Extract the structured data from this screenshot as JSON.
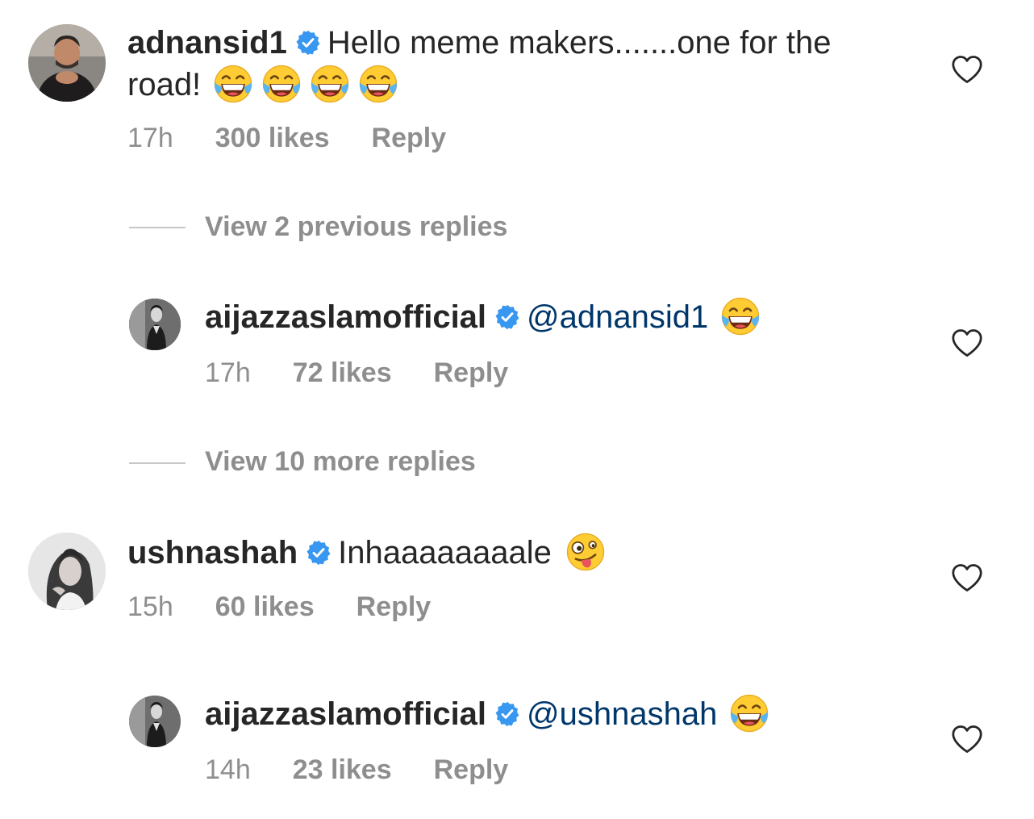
{
  "comments": [
    {
      "username": "adnansid1",
      "text_line1": "Hello meme makers.......one for the",
      "text_line2": "road!",
      "emojis": [
        "laughing-tears-emoji",
        "laughing-tears-emoji",
        "laughing-tears-emoji",
        "laughing-tears-emoji"
      ],
      "time": "17h",
      "likes": "300 likes",
      "reply": "Reply",
      "verified": true
    },
    {
      "username": "ushnashah",
      "text": "Inhaaaaaaaale",
      "emoji": "zany-face-emoji",
      "time": "15h",
      "likes": "60 likes",
      "reply": "Reply",
      "verified": true
    }
  ],
  "replies": [
    {
      "view_more": "View 2 previous replies",
      "username": "aijazzaslamofficial",
      "mention": "@adnansid1",
      "emoji": "laughing-tears-emoji",
      "time": "17h",
      "likes": "72 likes",
      "reply": "Reply",
      "verified": true
    },
    {
      "view_more": "View 10 more replies",
      "username": "aijazzaslamofficial",
      "mention": "@ushnashah",
      "emoji": "laughing-tears-emoji",
      "time": "14h",
      "likes": "23 likes",
      "reply": "Reply",
      "verified": true
    }
  ],
  "colors": {
    "text": "#262626",
    "secondary": "#8e8e8e",
    "mention": "#00376b",
    "verified": "#3897f0"
  }
}
